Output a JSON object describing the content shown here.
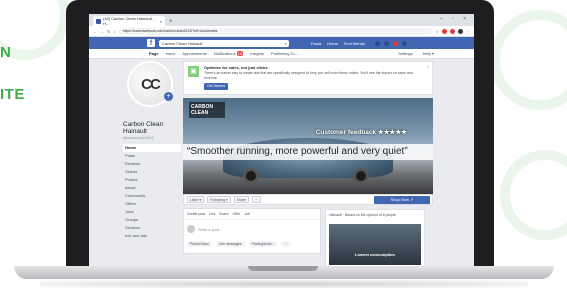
{
  "hero": {
    "line1": "N",
    "line2": "ITE"
  },
  "browser": {
    "tab_title": "(18) Carbon Clean Hainault - H...",
    "url": "https://www.facebook.com/carbonclean2013/?ref=bookmarks",
    "window_controls": "– ▫ ×"
  },
  "facebook": {
    "search_value": "Carbon Clean Hainault",
    "nav": [
      "Paula",
      "Home",
      "Find friends"
    ],
    "page_tabs": [
      "Page",
      "Inbox",
      "Appointments",
      "Notifications",
      "Insights",
      "Publishing To..."
    ],
    "notifications_count": "16",
    "page_tabs_right": [
      "Settings",
      "Help ▾"
    ]
  },
  "profile": {
    "logo_text": "CC",
    "name": "Carbon Clean Hainault",
    "handle": "@carbonclean2013",
    "nav": [
      "Home",
      "Posts",
      "Reviews",
      "Videos",
      "Photos",
      "About",
      "Community",
      "Offers",
      "Jobs",
      "Groups",
      "Services",
      "Info and ads"
    ]
  },
  "notice": {
    "title": "Optimise for sales, not just clicks",
    "body": "There's an easier way to create ads that are specifically designed to help you sell more items online. You'll see the impact on sales and revenue.",
    "button": "Get Started",
    "close": "×"
  },
  "cover": {
    "logo": "CARBON CLEAN",
    "feedback": "Customer feedback ★★★★★",
    "quote": "“Smoother running, more powerful and very quiet”"
  },
  "actions": {
    "buttons": [
      "Liked ▾",
      "Following ▾",
      "Share",
      "···"
    ],
    "shop": "Shop Now ↗"
  },
  "creator": {
    "top": [
      "Create post",
      "Live",
      "Event",
      "Offer",
      "Job"
    ],
    "placeholder": "Write a post...",
    "bottom": [
      "Photo/Video",
      "Get messages",
      "Feeling/Activ...",
      "···"
    ]
  },
  "sidecard": {
    "line": "Hainault · Based on the opinion of 6 people",
    "image_caption": "Lowest consumption"
  }
}
